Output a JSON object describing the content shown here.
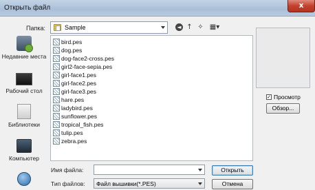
{
  "window": {
    "title": "Открыть файл",
    "close_glyph": "x"
  },
  "toolbar": {
    "look_in_label": "Папка:",
    "look_in_value": "Sample",
    "back_glyph": "◄",
    "up_glyph": "↑",
    "new_folder_glyph": "✧",
    "views_glyph": "▦▾"
  },
  "places": [
    {
      "label": "Недавние места"
    },
    {
      "label": "Рабочий стол"
    },
    {
      "label": "Библиотеки"
    },
    {
      "label": "Компьютер"
    },
    {
      "label": ""
    }
  ],
  "files": [
    "bird.pes",
    "dog.pes",
    "dog-face2-cross.pes",
    "girl2-face-sepia.pes",
    "girl-face1.pes",
    "girl-face2.pes",
    "girl-face3.pes",
    "hare.pes",
    "ladybird.pes",
    "sunflower.pes",
    "tropical_fish.pes",
    "tulip.pes",
    "zebra.pes"
  ],
  "preview": {
    "checkbox_label": "Просмотр",
    "checked": true,
    "check_glyph": "✓",
    "browse_label": "Обзор..."
  },
  "bottom": {
    "filename_label": "Имя файла:",
    "filename_value": "",
    "filetype_label": "Тип файлов:",
    "filetype_value": "Файл вышивки(*.PES)",
    "open_label": "Открыть",
    "cancel_label": "Отмена"
  }
}
